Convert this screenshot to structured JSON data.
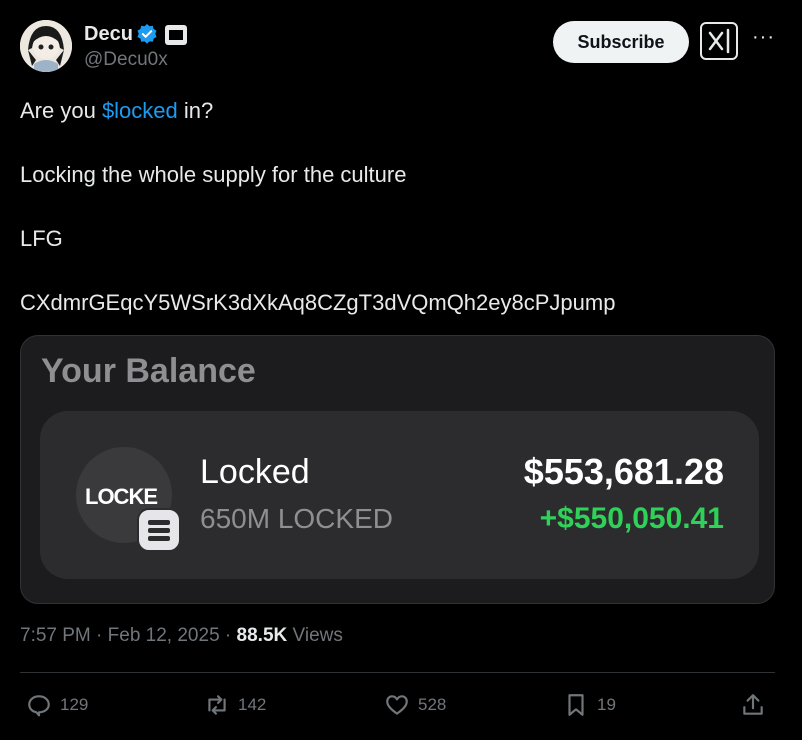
{
  "author": {
    "name": "Decu",
    "handle": "@Decu0x"
  },
  "header": {
    "subscribe_label": "Subscribe"
  },
  "tweet": {
    "line1_prefix": "Are you ",
    "line1_cashtag": "$locked",
    "line1_suffix": " in?",
    "line2": "Locking the whole supply for the culture",
    "line3": "LFG",
    "line4": "CXdmrGEqcY5WSrK3dXkAq8CZgT3dVQmQh2ey8cPJpump"
  },
  "media": {
    "title": "Your Balance",
    "token_logo_text": "LOCKE",
    "token_name": "Locked",
    "token_amount": "650M LOCKED",
    "token_value": "$553,681.28",
    "token_change": "+$550,050.41",
    "change_color": "#30d158"
  },
  "meta": {
    "time": "7:57 PM",
    "date": "Feb 12, 2025",
    "views_count": "88.5K",
    "views_label": "Views"
  },
  "actions": {
    "replies": "129",
    "reposts": "142",
    "likes": "528",
    "bookmarks": "19"
  },
  "colors": {
    "accent": "#1d9bf0",
    "background": "#000000",
    "muted": "#71767b"
  }
}
